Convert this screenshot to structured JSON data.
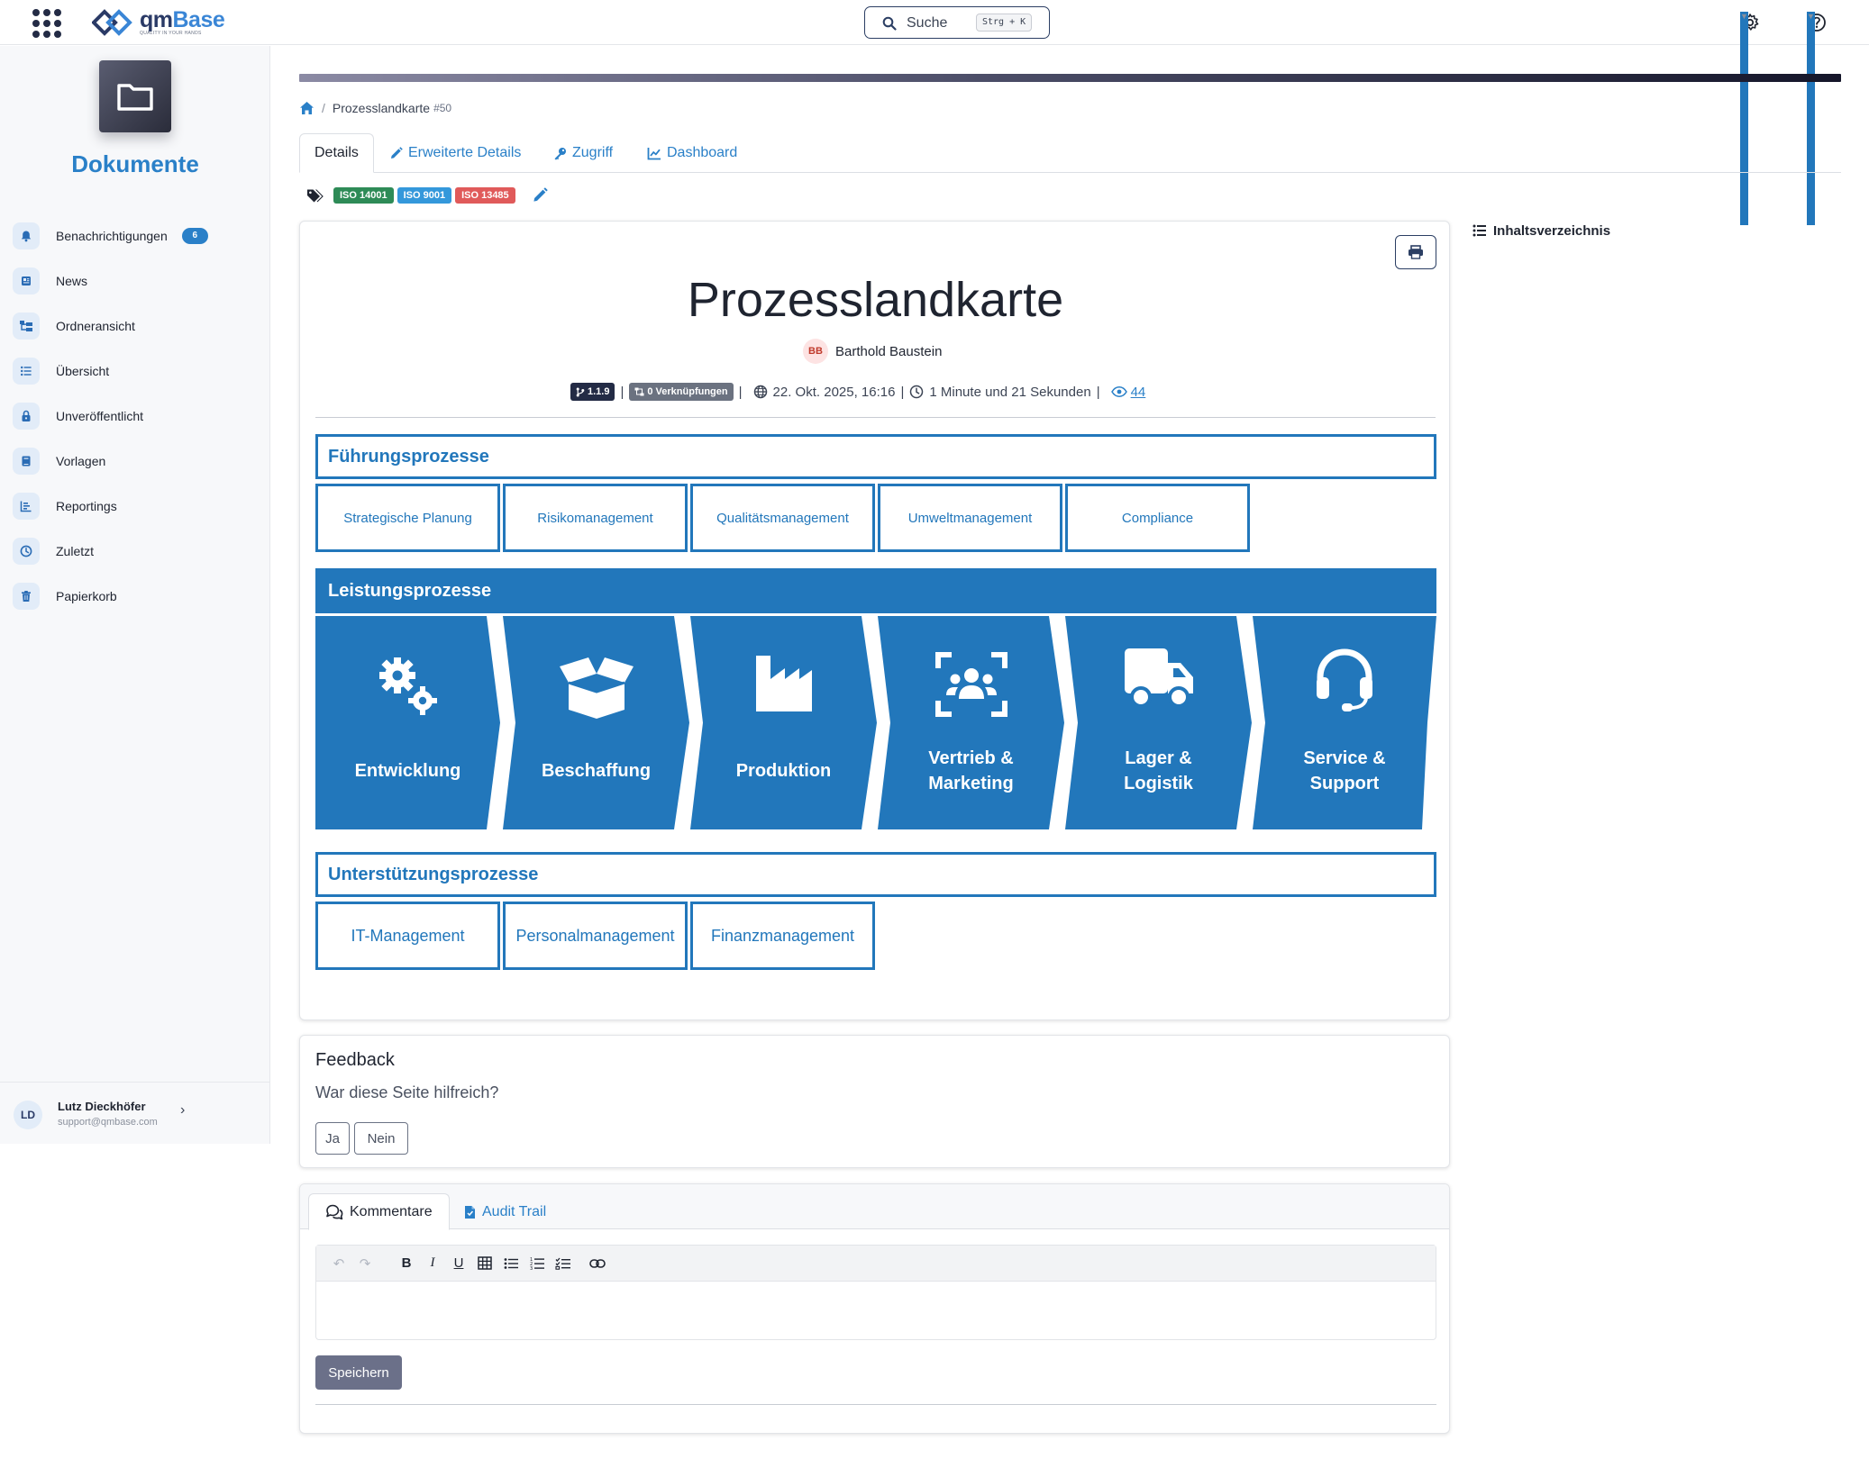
{
  "header": {
    "logo_text_main": "qm",
    "logo_text_accent": "Base",
    "logo_tagline": "QUALITY IN YOUR HANDS",
    "search_label": "Suche",
    "search_shortcut": "Strg + K"
  },
  "sidebar": {
    "title": "Dokumente",
    "items": [
      {
        "label": "Benachrichtigungen",
        "icon": "bell-icon",
        "badge": "6"
      },
      {
        "label": "News",
        "icon": "newspaper-icon"
      },
      {
        "label": "Ordneransicht",
        "icon": "folder-tree-icon"
      },
      {
        "label": "Übersicht",
        "icon": "list-icon"
      },
      {
        "label": "Unveröffentlicht",
        "icon": "lock-icon"
      },
      {
        "label": "Vorlagen",
        "icon": "book-icon"
      },
      {
        "label": "Reportings",
        "icon": "chart-icon"
      },
      {
        "label": "Zuletzt",
        "icon": "clock-icon"
      },
      {
        "label": "Papierkorb",
        "icon": "trash-icon"
      }
    ],
    "user": {
      "initials": "LD",
      "name": "Lutz Dieckhöfer",
      "email": "support@qmbase.com"
    }
  },
  "main": {
    "breadcrumb": {
      "separator": "/",
      "current": "Prozesslandkarte",
      "id": "#50"
    },
    "tabs": [
      {
        "label": "Details",
        "active": true
      },
      {
        "label": "Erweiterte Details"
      },
      {
        "label": "Zugriff"
      },
      {
        "label": "Dashboard"
      }
    ],
    "tags": [
      {
        "label": "ISO 14001",
        "color": "#2e8b57"
      },
      {
        "label": "ISO 9001",
        "color": "#3498db"
      },
      {
        "label": "ISO 13485",
        "color": "#e05a5a"
      }
    ],
    "toc_label": "Inhaltsverzeichnis"
  },
  "document": {
    "title": "Prozesslandkarte",
    "author_initials": "BB",
    "author": "Barthold Baustein",
    "version": "1.1.9",
    "links": "0 Verknüpfungen",
    "date": "22. Okt. 2025, 16:16",
    "reading_time": "1 Minute und 21 Sekunden",
    "views": "44",
    "sections": {
      "fuehrung": {
        "title": "Führungsprozesse",
        "items": [
          "Strategische Planung",
          "Risikomanagement",
          "Qualitätsmanagement",
          "Umweltmanagement",
          "Compliance"
        ]
      },
      "leistung": {
        "title": "Leistungsprozesse",
        "items": [
          {
            "line1": "Entwicklung",
            "line2": "",
            "icon": "gears-icon"
          },
          {
            "line1": "Beschaffung",
            "line2": "",
            "icon": "open-box-icon"
          },
          {
            "line1": "Produktion",
            "line2": "",
            "icon": "factory-icon"
          },
          {
            "line1": "Vertrieb &",
            "line2": "Marketing",
            "icon": "people-group-icon"
          },
          {
            "line1": "Lager &",
            "line2": "Logistik",
            "icon": "truck-icon"
          },
          {
            "line1": "Service &",
            "line2": "Support",
            "icon": "headset-icon"
          }
        ]
      },
      "unterstuetzung": {
        "title": "Unterstützungsprozesse",
        "items": [
          "IT-Management",
          "Personalmanagement",
          "Finanzmanagement"
        ]
      }
    }
  },
  "feedback": {
    "title": "Feedback",
    "question": "War diese Seite hilfreich?",
    "yes": "Ja",
    "no": "Nein"
  },
  "comments": {
    "tabs": [
      "Kommentare",
      "Audit Trail"
    ],
    "save_label": "Speichern"
  },
  "colors": {
    "accent": "#2a80c8",
    "process_blue": "#2277bb",
    "dark_navy": "#232b45"
  }
}
